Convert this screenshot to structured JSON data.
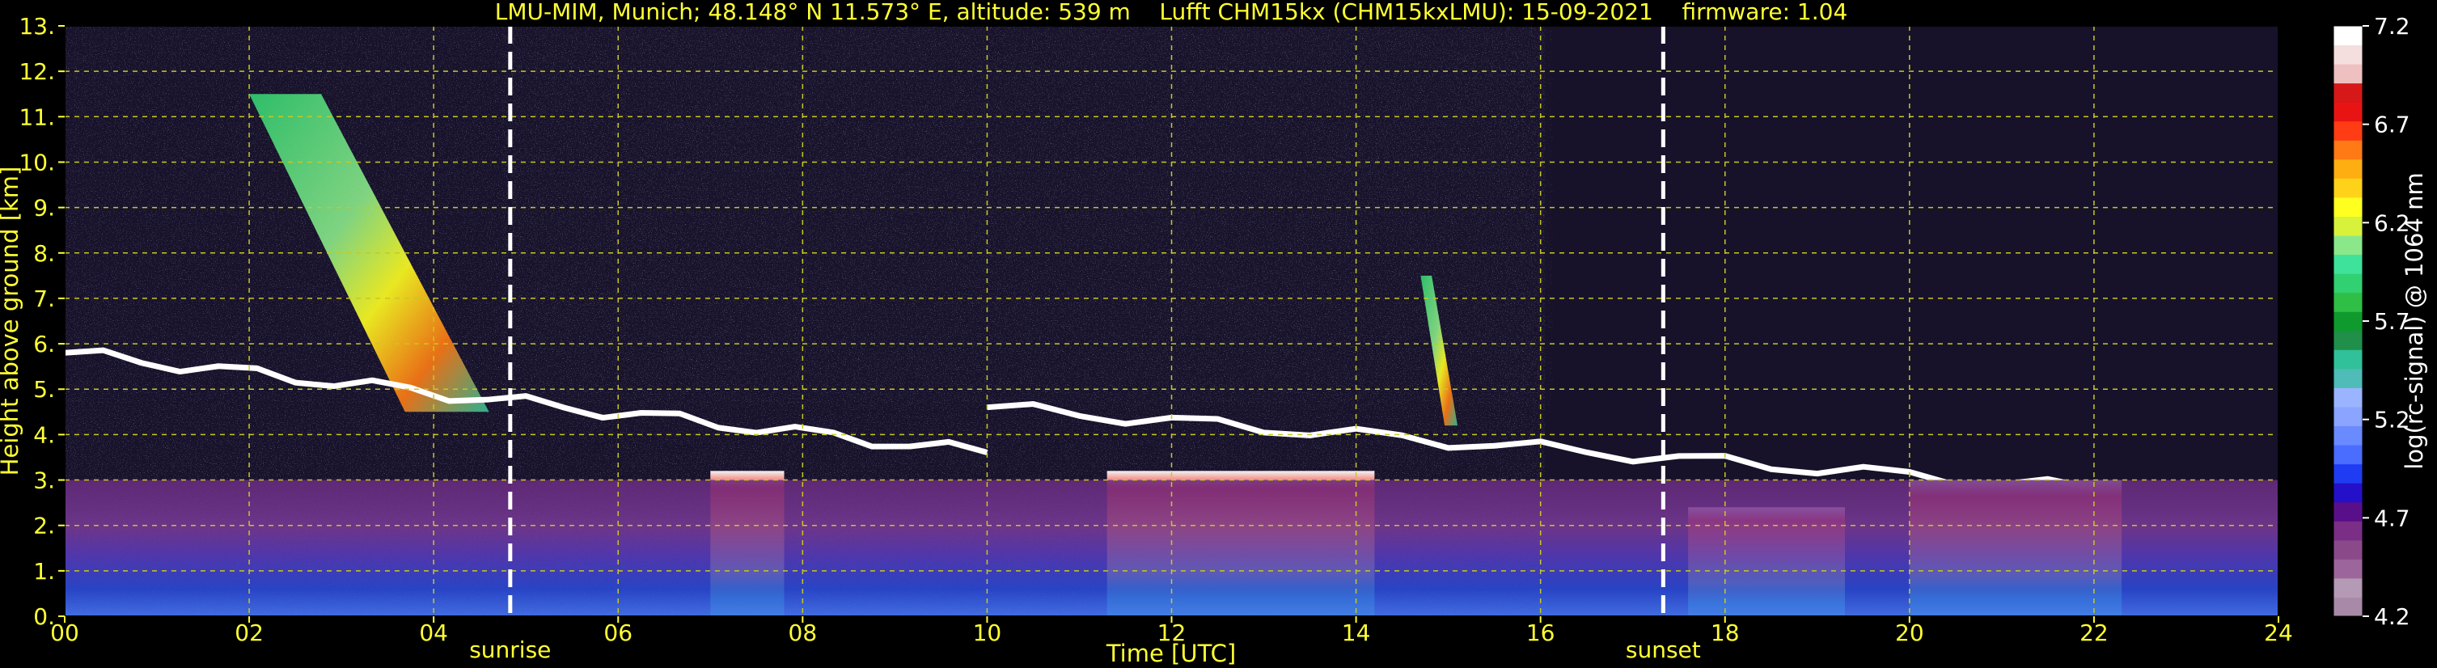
{
  "chart_data": {
    "type": "heatmap",
    "title": "LMU-MIM, Munich; 48.148° N 11.573° E, altitude: 539 m    Lufft CHM15kx (CHM15kxLMU): 15-09-2021    firmware: 1.04",
    "xlabel": "Time [UTC]",
    "ylabel": "Height above ground [km]",
    "xlim": [
      0,
      24
    ],
    "ylim": [
      0,
      13
    ],
    "x_ticks": [
      "00",
      "02",
      "04",
      "06",
      "08",
      "10",
      "12",
      "14",
      "16",
      "18",
      "20",
      "22",
      "24"
    ],
    "y_ticks": [
      "0.",
      "1.",
      "2.",
      "3.",
      "4.",
      "5.",
      "6.",
      "7.",
      "8.",
      "9.",
      "10.",
      "11.",
      "12.",
      "13."
    ],
    "grid": true,
    "colorbar": {
      "label": "log(rc-signal) @ 1064 nm",
      "range": [
        4.2,
        7.2
      ],
      "ticks": [
        "4.2",
        "4.7",
        "5.2",
        "5.7",
        "6.2",
        "6.7",
        "7.2"
      ],
      "colors": [
        "#a88aa8",
        "#b49ab4",
        "#9c669c",
        "#8a4a8a",
        "#7a2e86",
        "#5a0f8a",
        "#2410c8",
        "#1f3cf2",
        "#4a6cff",
        "#6a8aff",
        "#8aa4ff",
        "#9ab4ff",
        "#4fbcb8",
        "#31c19a",
        "#1f8f4a",
        "#0f9a2e",
        "#2fbf46",
        "#31d070",
        "#3fe29a",
        "#8ae88a",
        "#d8f23c",
        "#ffff20",
        "#ffd21a",
        "#ffae12",
        "#ff7a14",
        "#ff3c14",
        "#e81414",
        "#d61818",
        "#eec0c0",
        "#f4dede",
        "#ffffff"
      ]
    },
    "events": [
      {
        "label": "sunrise",
        "time": 4.83
      },
      {
        "label": "sunset",
        "time": 17.33
      }
    ],
    "features": [
      {
        "kind": "cirrus",
        "time": [
          2.0,
          4.6
        ],
        "height": [
          4.5,
          11.5
        ]
      },
      {
        "kind": "cloud-layer",
        "time": [
          0.0,
          10.0
        ],
        "height": [
          3.6,
          5.8
        ]
      },
      {
        "kind": "cloud-layer",
        "time": [
          10.0,
          22.0
        ],
        "height": [
          2.8,
          4.6
        ]
      },
      {
        "kind": "cloud-column",
        "time": [
          7.0,
          7.8
        ],
        "height": [
          0.0,
          3.2
        ]
      },
      {
        "kind": "cloud-column",
        "time": [
          11.3,
          14.2
        ],
        "height": [
          0.0,
          3.2
        ]
      },
      {
        "kind": "cloud-column",
        "time": [
          17.6,
          19.3
        ],
        "height": [
          0.0,
          2.4
        ]
      },
      {
        "kind": "cloud-column",
        "time": [
          20.0,
          22.3
        ],
        "height": [
          0.0,
          3.0
        ]
      },
      {
        "kind": "cirrus-streak",
        "time": [
          14.7,
          15.1
        ],
        "height": [
          4.2,
          7.5
        ]
      },
      {
        "kind": "boundary-layer",
        "time": [
          0.0,
          24.0
        ],
        "height": [
          0.0,
          3.0
        ]
      }
    ]
  }
}
